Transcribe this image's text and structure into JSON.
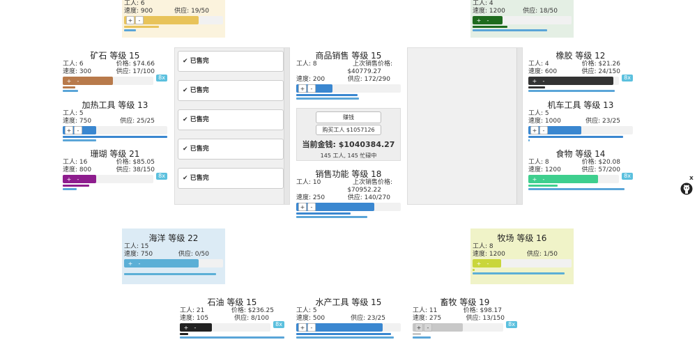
{
  "columns": {
    "left_panel": {
      "items": [
        "已售完",
        "已售完",
        "已售完",
        "已售完",
        "已售完"
      ]
    }
  },
  "top_left": {
    "workers_label": "工人:",
    "workers": "6",
    "speed_label": "速度:",
    "speed": "900",
    "supply_label": "供应:",
    "supply": "19/50"
  },
  "top_right": {
    "workers_label": "工人:",
    "workers": "4",
    "speed_label": "速度:",
    "speed": "1200",
    "supply_label": "供应:",
    "supply": "18/50"
  },
  "ore": {
    "title": "矿石 等级 15",
    "workers": "工人: 6",
    "price": "价格: $74.66",
    "speed": "速度: 300",
    "supply": "供应: 17/100",
    "mult": "8x"
  },
  "heating_tools": {
    "title": "加热工具 等级 13",
    "workers": "工人: 5",
    "speed": "速度: 750",
    "supply": "供应: 25/25"
  },
  "coral": {
    "title": "珊瑚 等级 21",
    "workers": "工人: 16",
    "price": "价格: $85.05",
    "speed": "速度: 800",
    "supply": "供应: 38/150",
    "mult": "8x"
  },
  "ocean": {
    "title": "海洋 等级 22",
    "workers": "工人: 15",
    "speed": "速度: 750",
    "supply": "供应: 0/50"
  },
  "rubber": {
    "title": "橡胶 等级 12",
    "workers": "工人: 4",
    "price": "价格: $21.26",
    "speed": "速度: 600",
    "supply": "供应: 24/150",
    "mult": "8x"
  },
  "lathe_tools": {
    "title": "机车工具 等级 13",
    "workers": "工人: 5",
    "speed": "速度: 1000",
    "supply": "供应: 23/25"
  },
  "food": {
    "title": "食物 等级 14",
    "workers": "工人: 8",
    "price": "价格: $20.08",
    "speed": "速度: 1200",
    "supply": "供应: 57/200",
    "mult": "8x"
  },
  "ranch": {
    "title": "牧场 等级 16",
    "workers": "工人: 8",
    "speed": "速度: 1200",
    "supply": "供应: 1/50"
  },
  "sales": {
    "title": "商品销售 等级 15",
    "workers": "工人: 8",
    "last_price_label": "上次销售价格:",
    "last_price": "$40779.27",
    "speed": "速度: 200",
    "supply": "供应: 172/290"
  },
  "money": {
    "earn": "赚钱",
    "hire": "购买工人 $1057126",
    "current": "当前金钱: $1040384.27",
    "status": "145 工人, 145 忙碌中"
  },
  "sales_func": {
    "title": "销售功能 等级 18",
    "workers": "工人: 10",
    "last_price_label": "上次销售价格:",
    "last_price": "$70952.22",
    "speed": "速度: 250",
    "supply": "供应: 140/270"
  },
  "oil": {
    "title": "石油 等级 15",
    "workers": "工人: 21",
    "price": "价格: $236.25",
    "speed": "速度: 105",
    "supply": "供应: 8/100",
    "mult": "8x"
  },
  "aqua_tools": {
    "title": "水产工具 等级 15",
    "workers": "工人: 5",
    "speed": "速度: 500",
    "supply": "供应: 23/25"
  },
  "livestock": {
    "title": "畜牧 等级 19",
    "workers": "工人: 11",
    "price": "价格: $98.17",
    "speed": "速度: 275",
    "supply": "供应: 13/150",
    "mult": "8x"
  },
  "colors": {
    "ore": "#b87a4b",
    "coral": "#8e1d8e",
    "ocean": "#5bafd6",
    "rubber": "#333333",
    "food": "#3ecf8e",
    "ranch": "#c9d63b",
    "oil": "#222222",
    "blue": "#3a87d0",
    "gray": "#bdbdbd",
    "green": "#1e6b1e",
    "gold": "#e8c35a"
  },
  "icons": {
    "check": "check-icon",
    "github": "github-icon",
    "close": "close-icon"
  }
}
